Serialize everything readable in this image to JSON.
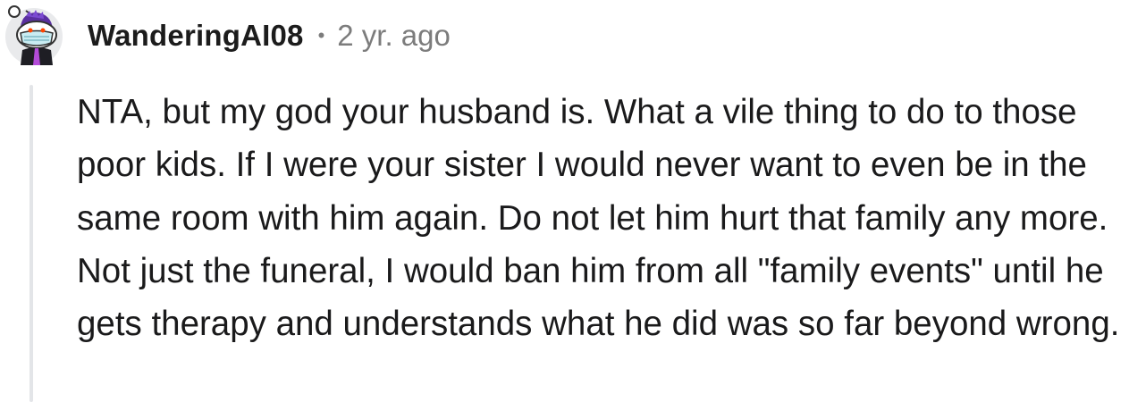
{
  "comment": {
    "author": "WanderingAI08",
    "separator": "•",
    "timestamp": "2 yr. ago",
    "avatar_icon": "snoo-avatar-icon",
    "body": "NTA, but my god your husband is. What a vile thing to do to those poor kids. If I were your sister I would never want to even be in the same room with him again. Do not let him hurt that family any more. Not just the funeral, I would ban him from all \"family events\" until he gets therapy and understands what he did was so far beyond wrong."
  }
}
